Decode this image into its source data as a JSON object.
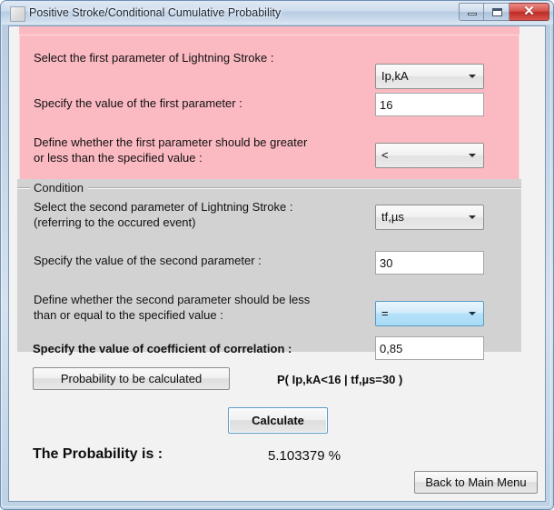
{
  "window": {
    "title": "Positive Stroke/Conditional Cumulative Probability",
    "icon": "application-icon",
    "minimize_label": "–",
    "maximize_label": "□",
    "close_label": "✕"
  },
  "first_parameter_panel": {
    "select_label": "Select the first parameter of Lightning Stroke :",
    "select_value": "Ip,kA",
    "value_label": "Specify the value of the first parameter :",
    "value": "16",
    "comparison_label": "Define whether the first parameter should be greater\nor less than the specified value :",
    "comparison_value": "<"
  },
  "condition_group": {
    "legend": "Condition",
    "select_label": "Select the second parameter of Lightning Stroke :\n(referring to the occured event)",
    "select_value": "tf,µs",
    "value_label": "Specify the value of the second parameter :",
    "value": "30",
    "comparison_label": "Define whether the second parameter should be less\nthan or equal to the specified value :",
    "comparison_value": "="
  },
  "correlation": {
    "label": "Specify the value of coefficient of correlation :",
    "value": "0,85"
  },
  "actions": {
    "probability_button": "Probability to be calculated",
    "formula": "P( Ip,kA<16 | tf,µs=30 )",
    "calculate_button": "Calculate",
    "back_button": "Back to Main Menu"
  },
  "result": {
    "label": "The Probability is :",
    "value": "5.103379 %"
  },
  "colors": {
    "panel_pink": "#fbb9c2",
    "condition_gray": "#d2d2d2",
    "client_bg": "#f2f2f2",
    "focus_blue": "#5b9bc4",
    "close_red": "#bd2d26"
  }
}
